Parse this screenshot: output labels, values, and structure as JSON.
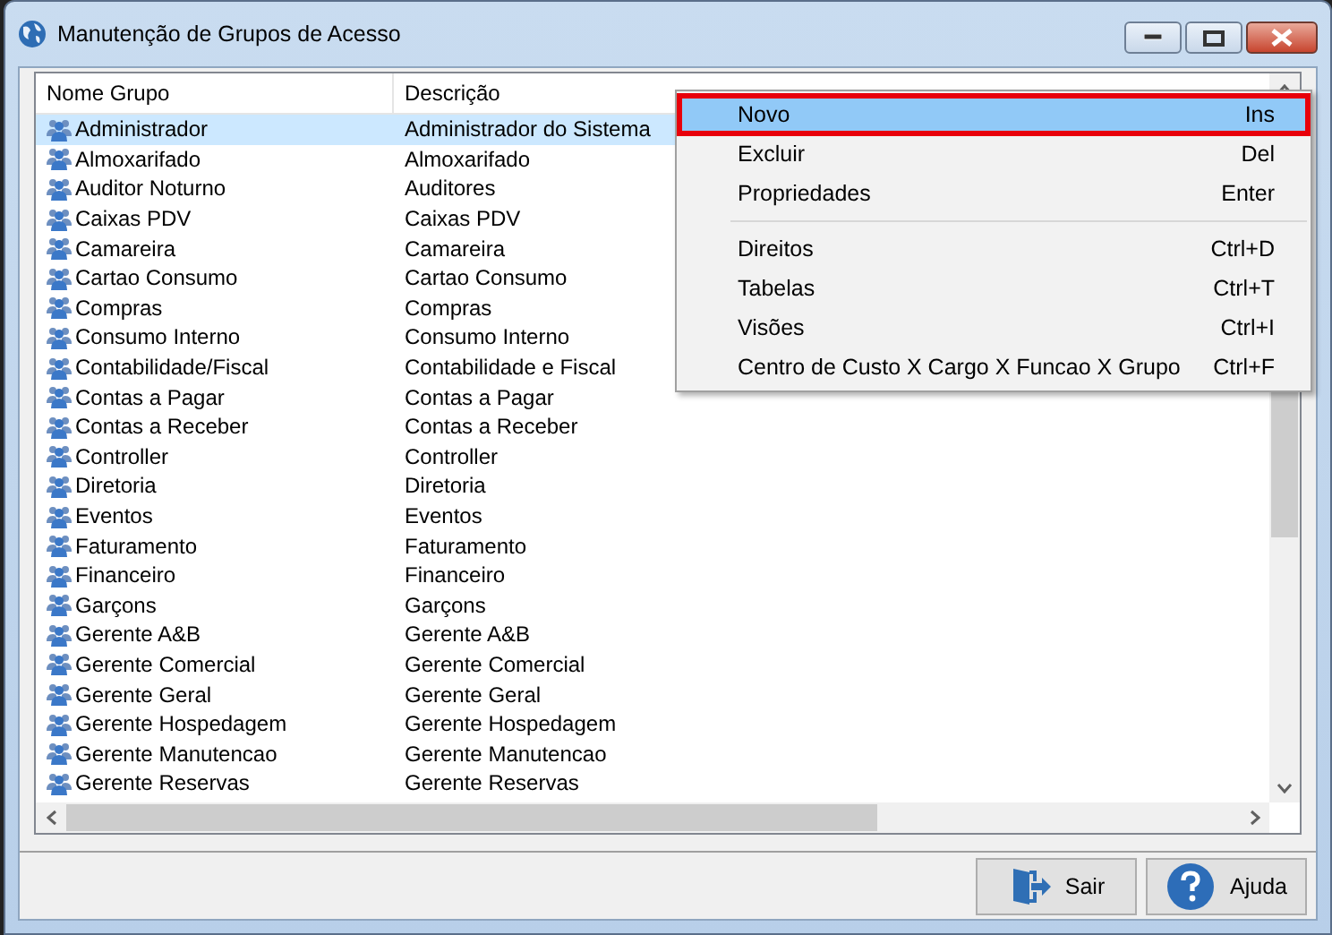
{
  "window": {
    "title": "Manutenção de Grupos de Acesso"
  },
  "table": {
    "columns": [
      "Nome Grupo",
      "Descrição"
    ],
    "rows": [
      {
        "name": "Administrador",
        "description": "Administrador do Sistema",
        "selected": true
      },
      {
        "name": "Almoxarifado",
        "description": "Almoxarifado",
        "selected": false
      },
      {
        "name": "Auditor Noturno",
        "description": "Auditores",
        "selected": false
      },
      {
        "name": "Caixas PDV",
        "description": "Caixas PDV",
        "selected": false
      },
      {
        "name": "Camareira",
        "description": "Camareira",
        "selected": false
      },
      {
        "name": "Cartao Consumo",
        "description": "Cartao Consumo",
        "selected": false
      },
      {
        "name": "Compras",
        "description": "Compras",
        "selected": false
      },
      {
        "name": "Consumo Interno",
        "description": "Consumo Interno",
        "selected": false
      },
      {
        "name": "Contabilidade/Fiscal",
        "description": "Contabilidade e Fiscal",
        "selected": false
      },
      {
        "name": "Contas a Pagar",
        "description": "Contas a Pagar",
        "selected": false
      },
      {
        "name": "Contas a Receber",
        "description": "Contas a Receber",
        "selected": false
      },
      {
        "name": "Controller",
        "description": "Controller",
        "selected": false
      },
      {
        "name": "Diretoria",
        "description": "Diretoria",
        "selected": false
      },
      {
        "name": "Eventos",
        "description": "Eventos",
        "selected": false
      },
      {
        "name": "Faturamento",
        "description": "Faturamento",
        "selected": false
      },
      {
        "name": "Financeiro",
        "description": "Financeiro",
        "selected": false
      },
      {
        "name": "Garçons",
        "description": "Garçons",
        "selected": false
      },
      {
        "name": "Gerente A&B",
        "description": "Gerente A&B",
        "selected": false
      },
      {
        "name": "Gerente Comercial",
        "description": "Gerente Comercial",
        "selected": false
      },
      {
        "name": "Gerente Geral",
        "description": "Gerente Geral",
        "selected": false
      },
      {
        "name": "Gerente Hospedagem",
        "description": "Gerente Hospedagem",
        "selected": false
      },
      {
        "name": "Gerente Manutencao",
        "description": "Gerente Manutencao",
        "selected": false
      },
      {
        "name": "Gerente Reservas",
        "description": "Gerente Reservas",
        "selected": false
      }
    ]
  },
  "context_menu": {
    "groups": [
      [
        {
          "label": "Novo",
          "shortcut": "Ins",
          "selected": true,
          "outlined": true
        },
        {
          "label": "Excluir",
          "shortcut": "Del",
          "selected": false,
          "outlined": false
        },
        {
          "label": "Propriedades",
          "shortcut": "Enter",
          "selected": false,
          "outlined": false
        }
      ],
      [
        {
          "label": "Direitos",
          "shortcut": "Ctrl+D",
          "selected": false,
          "outlined": false
        },
        {
          "label": "Tabelas",
          "shortcut": "Ctrl+T",
          "selected": false,
          "outlined": false
        },
        {
          "label": "Visões",
          "shortcut": "Ctrl+I",
          "selected": false,
          "outlined": false
        },
        {
          "label": "Centro de Custo X Cargo X Funcao X Grupo",
          "shortcut": "Ctrl+F",
          "selected": false,
          "outlined": false
        }
      ]
    ]
  },
  "buttons": [
    {
      "kind": "exit",
      "label": "Sair"
    },
    {
      "kind": "help",
      "label": "Ajuda"
    }
  ]
}
